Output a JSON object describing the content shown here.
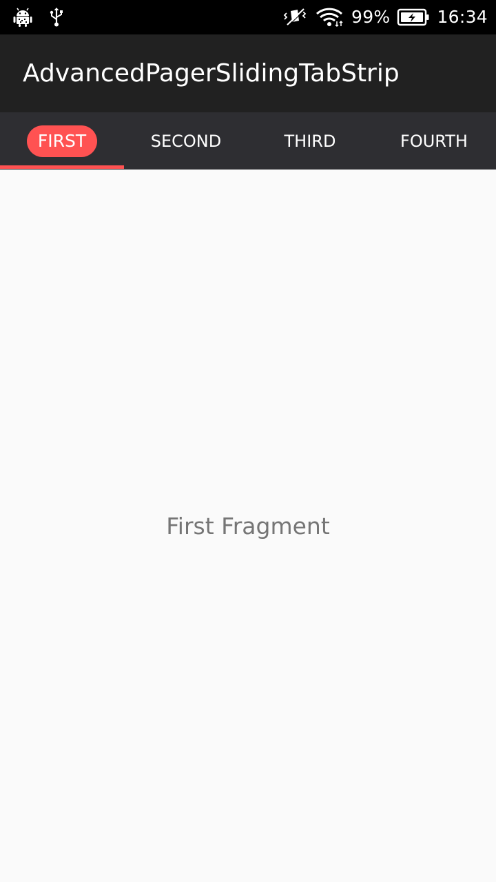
{
  "status_bar": {
    "icons_left": [
      "android-debug-icon",
      "usb-icon"
    ],
    "icons_right": [
      "vibrate-silent-icon",
      "wifi-icon",
      "battery-charging-icon"
    ],
    "battery": "99%",
    "time": "16:34"
  },
  "app_bar": {
    "title": "AdvancedPagerSlidingTabStrip"
  },
  "tabs": [
    {
      "label": "FIRST",
      "selected": true
    },
    {
      "label": "SECOND",
      "selected": false
    },
    {
      "label": "THIRD",
      "selected": false
    },
    {
      "label": "FOURTH",
      "selected": false
    }
  ],
  "colors": {
    "accent": "#ff5252",
    "app_bar": "#212121",
    "tab_strip": "#2e2e32",
    "content_bg": "#fafafa",
    "content_text": "#757575"
  },
  "content": {
    "text": "First Fragment"
  }
}
